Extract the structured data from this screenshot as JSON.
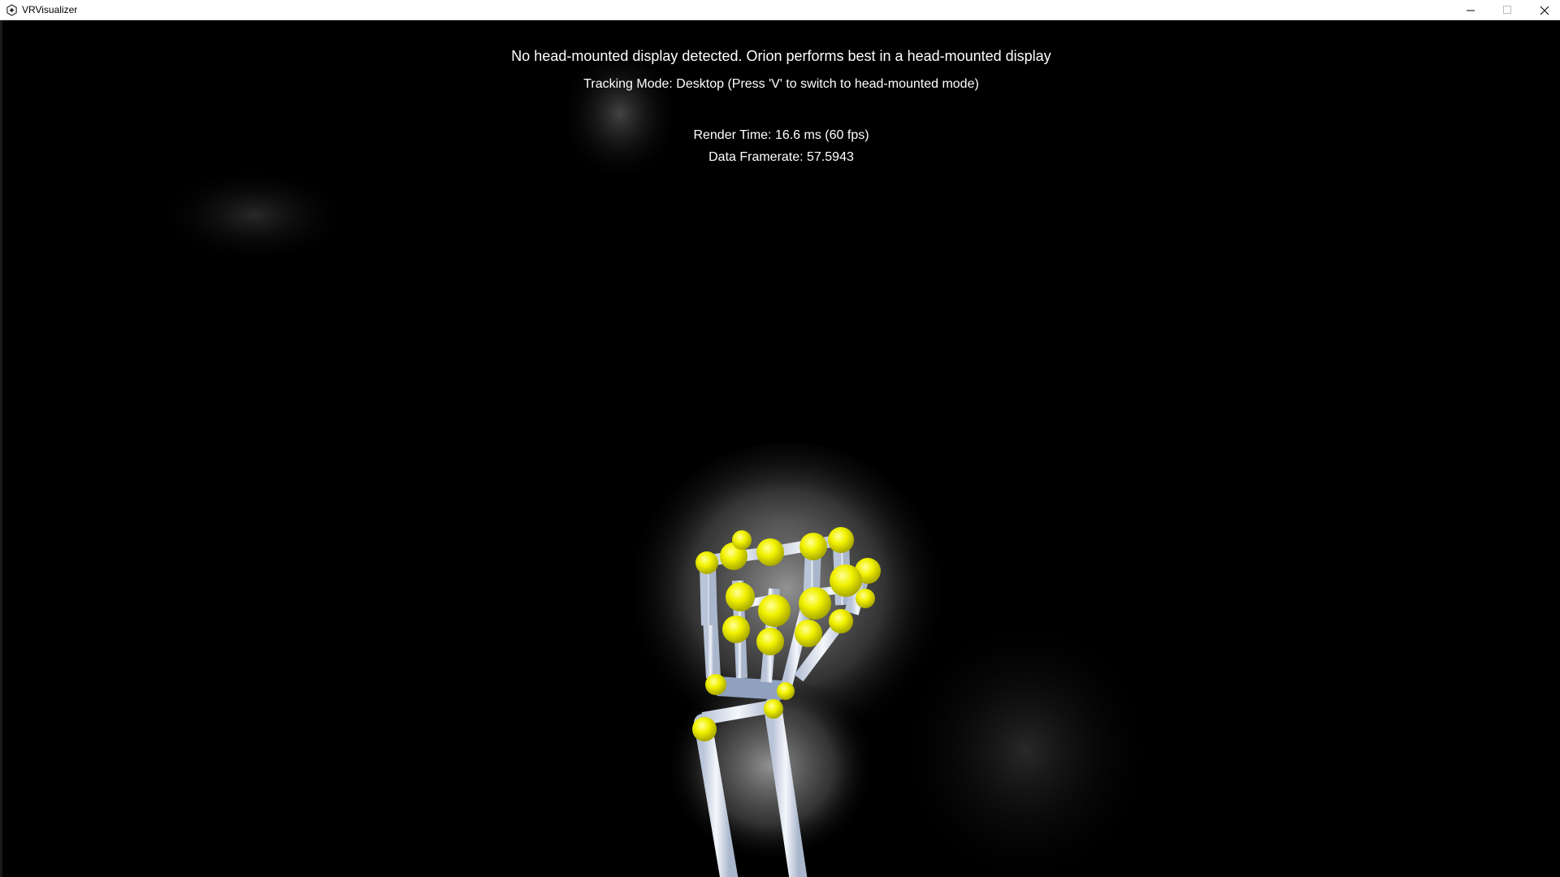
{
  "window": {
    "title": "VRVisualizer",
    "controls": {
      "minimize": "minimize-icon",
      "maximize": "maximize-icon",
      "close": "close-icon"
    }
  },
  "overlay": {
    "headset_message": "No head-mounted display detected. Orion performs best in a head-mounted display",
    "tracking_mode": "Tracking Mode: Desktop (Press 'V' to switch to head-mounted mode)",
    "render_time": "Render Time: 16.6 ms (60 fps)",
    "data_framerate": "Data Framerate: 57.5943"
  },
  "colors": {
    "background": "#000000",
    "joint": "#f2f200",
    "bone": "#e6ecf5",
    "overlay_text": "#ffffff"
  }
}
